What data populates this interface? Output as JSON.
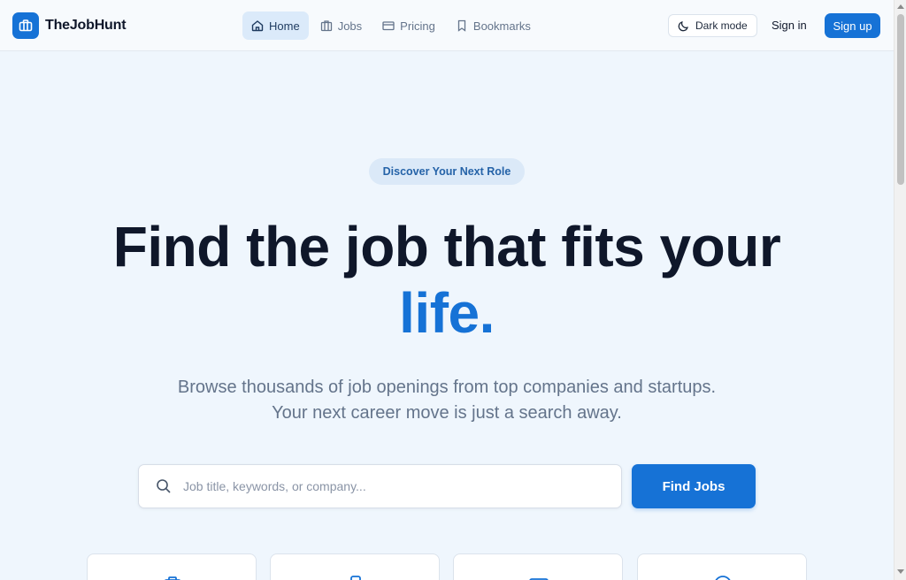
{
  "brand": {
    "name": "TheJobHunt",
    "logo_icon": "briefcase-icon"
  },
  "nav": {
    "items": [
      {
        "label": "Home",
        "icon": "home-icon",
        "active": true
      },
      {
        "label": "Jobs",
        "icon": "building-icon",
        "active": false
      },
      {
        "label": "Pricing",
        "icon": "credit-card-icon",
        "active": false
      },
      {
        "label": "Bookmarks",
        "icon": "bookmark-icon",
        "active": false
      }
    ]
  },
  "header": {
    "dark_mode_label": "Dark mode",
    "dark_mode_icon": "moon-icon",
    "signin_label": "Sign in",
    "signup_label": "Sign up"
  },
  "hero": {
    "badge": "Discover Your Next Role",
    "title_main": "Find the job that fits your",
    "title_accent": "life.",
    "subtitle_line1": "Browse thousands of job openings from top companies and startups.",
    "subtitle_line2": "Your next career move is just a search away."
  },
  "search": {
    "placeholder": "Job title, keywords, or company...",
    "value": "",
    "button_label": "Find Jobs"
  },
  "feature_cards": [
    {
      "icon": "briefcase-icon"
    },
    {
      "icon": "device-icon"
    },
    {
      "icon": "card-icon"
    },
    {
      "icon": "clock-icon"
    }
  ],
  "colors": {
    "accent": "#1672d6",
    "background": "#eff6fd",
    "heading": "#0f172a",
    "muted": "#64748b"
  }
}
